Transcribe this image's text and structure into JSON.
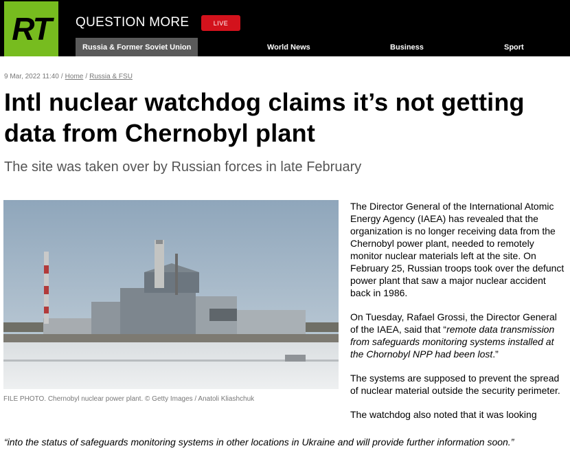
{
  "header": {
    "logo": "RT",
    "tagline": "QUESTION MORE",
    "live_label": "LIVE",
    "nav": [
      {
        "label": "Russia & Former Soviet Union",
        "active": true
      },
      {
        "label": "World News",
        "active": false
      },
      {
        "label": "Business",
        "active": false
      },
      {
        "label": "Sport",
        "active": false
      }
    ]
  },
  "article": {
    "date": "9 Mar, 2022 11:40",
    "breadcrumb": [
      "Home",
      "Russia & FSU"
    ],
    "headline": "Intl nuclear watchdog claims it’s not getting data from Chernobyl plant",
    "subtitle": "The site was taken over by Russian forces in late February",
    "photo_caption": "FILE PHOTO. Chernobyl nuclear power plant. © Getty Images / Anatoli Kliashchuk",
    "paragraphs": {
      "p1": "The Director General of the International Atomic Energy Agency (IAEA) has revealed that the organization is no longer receiving data from the Chernobyl power plant, needed to remotely monitor nuclear materials left at the site. On February 25, Russian troops took over the defunct power plant that saw a major nuclear accident back in 1986.",
      "p2_start": "On Tuesday, Rafael Grossi, the Director General of the IAEA, said that “",
      "p2_quote": "remote data transmission from safeguards monitoring systems installed at the Chornobyl NPP had been lost",
      "p2_end": ".”",
      "p3": "The systems are supposed to prevent the spread of nuclear material outside the security perimeter.",
      "p4_start": "The watchdog also noted that it was looking",
      "p4_quote": "“into the status of safeguards monitoring systems in other locations in Ukraine and will provide further information soon.”"
    }
  },
  "colors": {
    "header_bg": "#000000",
    "logo_bg": "#77bc1f",
    "live_bg": "#d3121c",
    "nav_active_bg": "#5a5a5a"
  }
}
